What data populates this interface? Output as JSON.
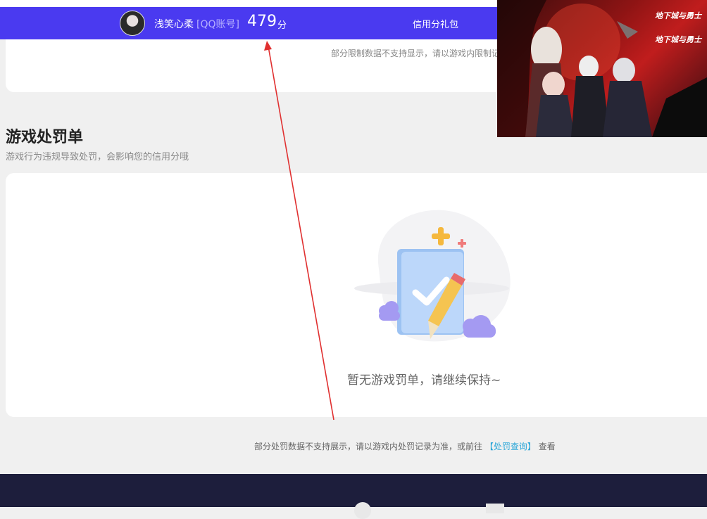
{
  "header": {
    "username": "浅笑心柔",
    "account_tag": "[QQ账号]",
    "score": "479",
    "score_unit": "分",
    "gift_label": "信用分礼包"
  },
  "top_card": {
    "note": "部分限制数据不支持显示，请以游戏内限制记"
  },
  "penalty": {
    "title": "游戏处罚单",
    "subtitle": "游戏行为违规导致处罚，会影响您的信用分哦",
    "empty_text": "暂无游戏罚单，请继续保持~",
    "note_prefix": "部分处罚数据不支持展示，请以游戏内处罚记录为准，或前往",
    "note_link": "【处罚查询】",
    "note_suffix": "查看"
  },
  "ad": {
    "logo_top": "地下城与勇士",
    "logo_bottom": "地下城与勇士"
  },
  "colors": {
    "header_bg": "#4a3af0",
    "link": "#2aa6d8",
    "footer_bg": "#1d1e3c",
    "arrow": "#e03030"
  },
  "icons": [
    "avatar",
    "empty-folder-illustration",
    "pencil-icon",
    "check-icon",
    "cloud-icon",
    "sparkle-icon",
    "arrow-annotation"
  ]
}
